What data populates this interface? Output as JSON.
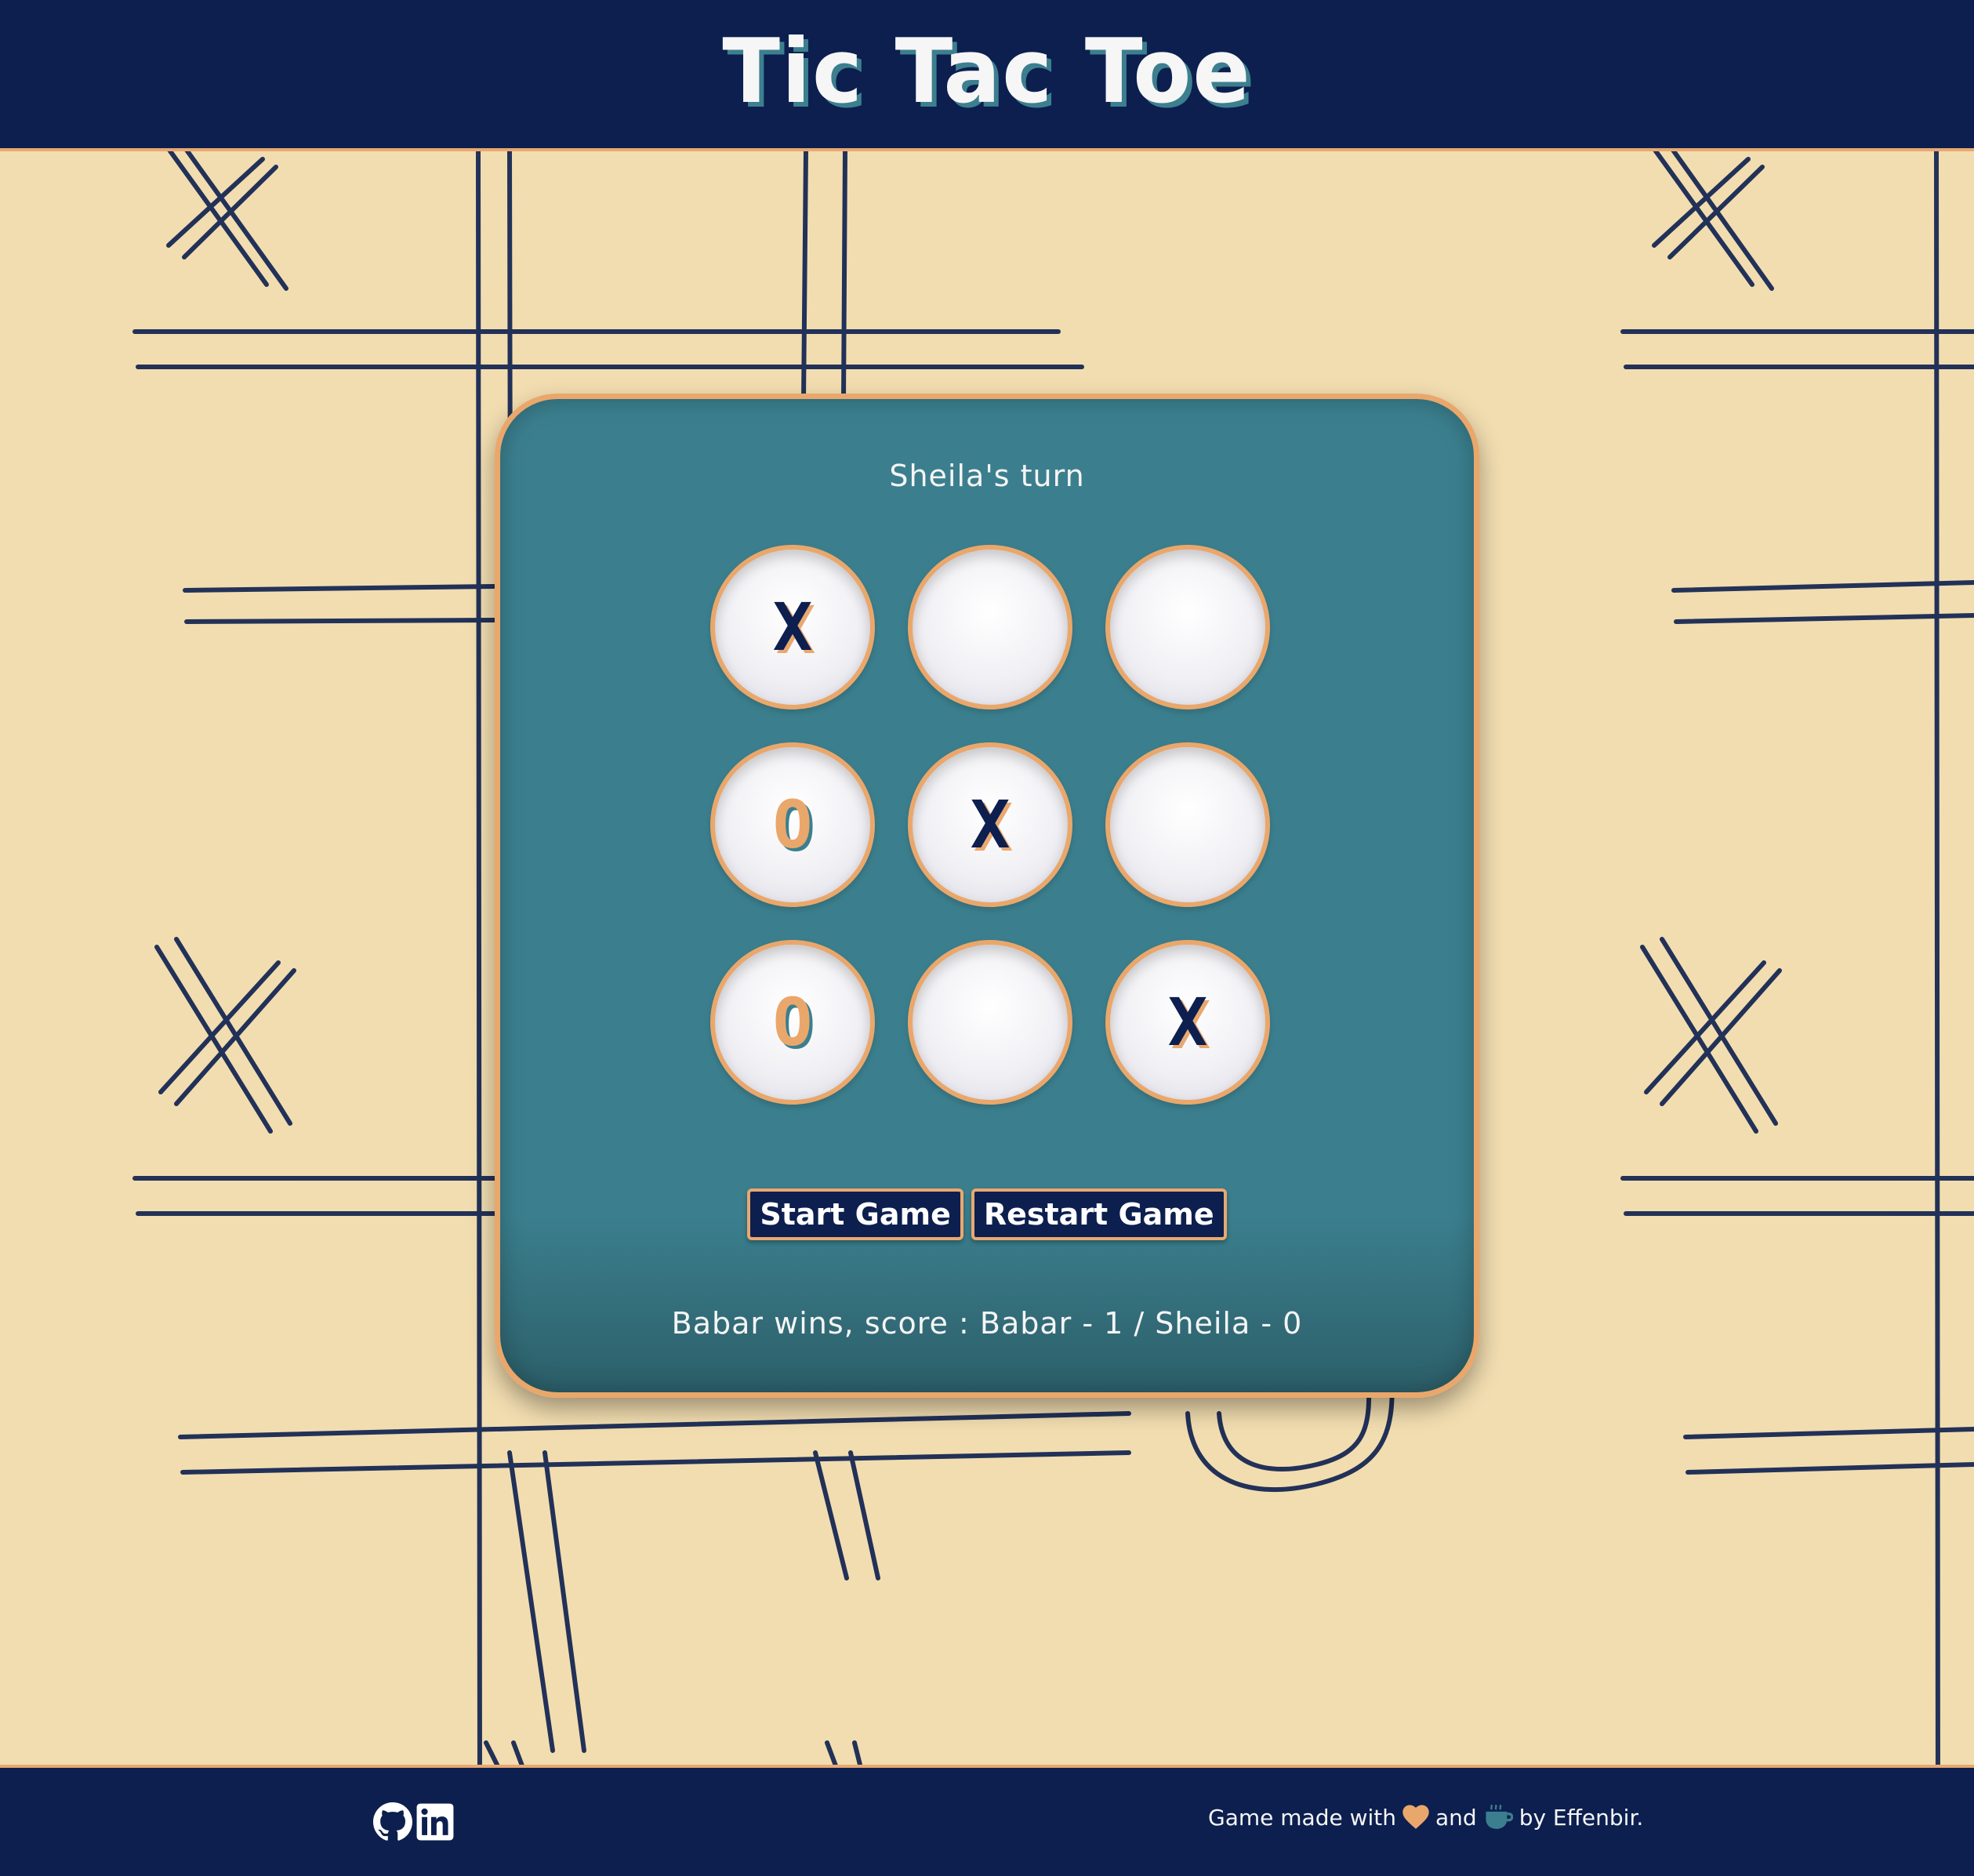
{
  "header": {
    "title": "Tic Tac Toe"
  },
  "game": {
    "turn_text": "Sheila's turn",
    "board": [
      "X",
      "",
      "",
      "O",
      "X",
      "",
      "O",
      "",
      "X"
    ],
    "start_label": "Start Game",
    "restart_label": "Restart Game",
    "score_text": "Babar wins, score : Babar - 1 / Sheila - 0"
  },
  "footer": {
    "social": [
      "github-icon",
      "linkedin-icon"
    ],
    "credit_part1": "Game made with",
    "credit_icon1": "heart-icon",
    "credit_part2": "and",
    "credit_icon2": "coffee-cup-icon",
    "credit_part3": "by Effenbir."
  },
  "colors": {
    "navy": "#0c1f4f",
    "teal": "#3b7f8e",
    "orange": "#eaa76b",
    "sand": "#f2ddb0"
  }
}
